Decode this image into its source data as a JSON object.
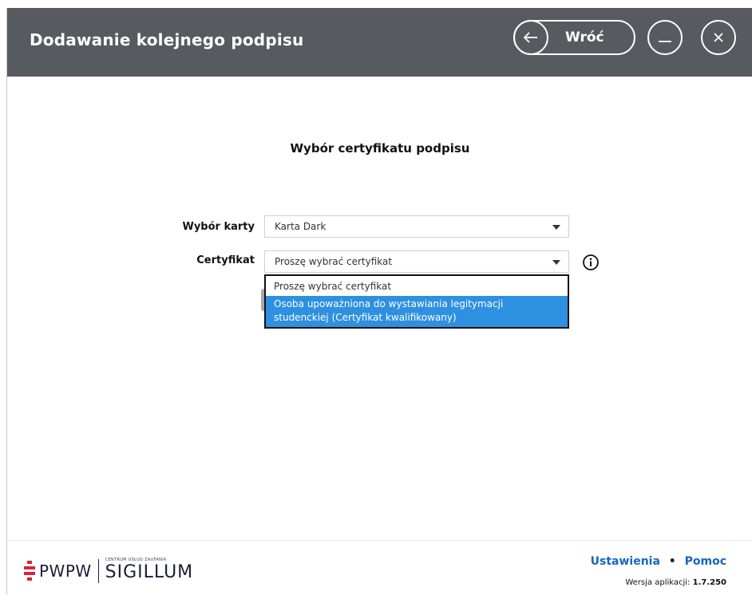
{
  "window": {
    "title": "Dodawanie kolejnego podpisu"
  },
  "header": {
    "back_label": "Wróć"
  },
  "main": {
    "section_title": "Wybór certyfikatu podpisu",
    "card_label": "Wybór karty",
    "card_value": "Karta Dark",
    "certificate_label": "Certyfikat",
    "certificate_value": "Proszę wybrać certyfikat",
    "dropdown_options": [
      "Proszę wybrać certyfikat",
      "Osoba upoważniona do wystawiania legitymacji studenckiej (Certyfikat kwalifikowany)"
    ],
    "selected_option_index": 1
  },
  "footer": {
    "logo_brand": "PWPW",
    "logo_small_text": "CENTRUM USŁUG ZAUFANIA",
    "logo_product": "SIGILLUM",
    "settings_link": "Ustawienia",
    "separator": "•",
    "help_link": "Pomoc",
    "version_label": "Wersja aplikacji:",
    "version_value": "1.7.250"
  },
  "colors": {
    "titlebar": "#575b5f",
    "highlight": "#2e90e0",
    "link": "#1565c0",
    "logo": "#1c1c3a",
    "logo_accent": "#d6253a"
  },
  "icons": [
    "arrow-left-icon",
    "minimize-icon",
    "close-icon",
    "chevron-down-icon",
    "info-icon",
    "pwpw-logo-icon"
  ]
}
